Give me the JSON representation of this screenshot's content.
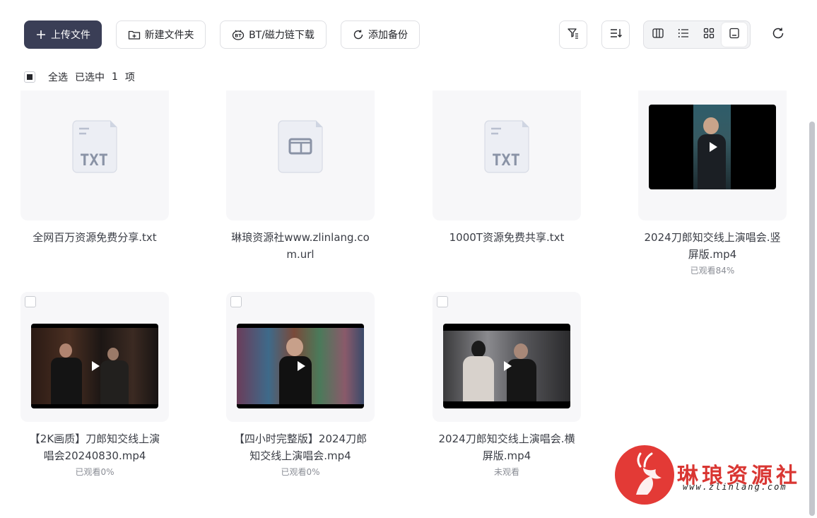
{
  "toolbar": {
    "upload_label": "上传文件",
    "new_folder_label": "新建文件夹",
    "bt_label": "BT/磁力链下载",
    "backup_label": "添加备份"
  },
  "selection": {
    "select_all": "全选",
    "selected_prefix": "已选中",
    "selected_count": "1",
    "selected_suffix": "项"
  },
  "files": [
    {
      "name": "全网百万资源免费分享.txt",
      "type": "txt",
      "badge": "TXT",
      "status": ""
    },
    {
      "name": "琳琅资源社www.zlinlang.com.url",
      "type": "url",
      "badge": "",
      "status": ""
    },
    {
      "name": "1000T资源免费共享.txt",
      "type": "txt",
      "badge": "TXT",
      "status": ""
    },
    {
      "name": "2024刀郎知交线上演唱会.竖屏版.mp4",
      "type": "video",
      "badge": "",
      "status": "已观看84%"
    },
    {
      "name": "【2K画质】刀郎知交线上演唱会20240830.mp4",
      "type": "video",
      "badge": "",
      "status": "已观看0%"
    },
    {
      "name": "【四小时完整版】2024刀郎知交线上演唱会.mp4",
      "type": "video",
      "badge": "",
      "status": "已观看0%"
    },
    {
      "name": "2024刀郎知交线上演唱会.横屏版.mp4",
      "type": "video",
      "badge": "",
      "status": "未观看"
    }
  ],
  "watermark": {
    "title": "琳琅资源社",
    "url": "www.zlinlang.com"
  },
  "colors": {
    "primary_button": "#3a3e56",
    "card_bg": "#f7f7f9",
    "watermark_red": "#e33a36"
  }
}
